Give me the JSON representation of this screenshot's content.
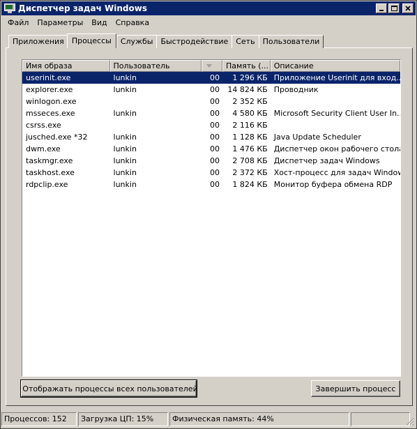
{
  "window": {
    "title": "Диспетчер задач Windows"
  },
  "menu": [
    "Файл",
    "Параметры",
    "Вид",
    "Справка"
  ],
  "tabs": [
    "Приложения",
    "Процессы",
    "Службы",
    "Быстродействие",
    "Сеть",
    "Пользователи"
  ],
  "active_tab": "Процессы",
  "table": {
    "columns": [
      "Имя образа",
      "Пользователь",
      "",
      "Память (...",
      "Описание"
    ],
    "rows": [
      [
        "userinit.exe",
        "lunkin",
        "00",
        "1 296 КБ",
        "Приложение Userinit для вход..."
      ],
      [
        "explorer.exe",
        "lunkin",
        "00",
        "14 824 КБ",
        "Проводник"
      ],
      [
        "winlogon.exe",
        "",
        "00",
        "2 352 КБ",
        ""
      ],
      [
        "msseces.exe",
        "lunkin",
        "00",
        "4 580 КБ",
        "Microsoft Security Client User In..."
      ],
      [
        "csrss.exe",
        "",
        "00",
        "2 116 КБ",
        ""
      ],
      [
        "jusched.exe *32",
        "lunkin",
        "00",
        "1 128 КБ",
        "Java Update Scheduler"
      ],
      [
        "dwm.exe",
        "lunkin",
        "00",
        "1 476 КБ",
        "Диспетчер окон рабочего стола"
      ],
      [
        "taskmgr.exe",
        "lunkin",
        "00",
        "2 708 КБ",
        "Диспетчер задач Windows"
      ],
      [
        "taskhost.exe",
        "lunkin",
        "00",
        "2 372 КБ",
        "Хост-процесс для задач Windows"
      ],
      [
        "rdpclip.exe",
        "lunkin",
        "00",
        "1 824 КБ",
        "Монитор буфера обмена RDP"
      ]
    ],
    "selected_row": 0
  },
  "buttons": {
    "show_all": "Отображать процессы всех пользователей",
    "end_process": "Завершить процесс"
  },
  "status": {
    "processes": "Процессов: 152",
    "cpu": "Загрузка ЦП: 15%",
    "memory": "Физическая память: 44%"
  },
  "colors": {
    "title_bg": "#0a246a",
    "selection": "#0a246a",
    "face": "#d4d0c8"
  },
  "icons": {
    "app": "task-manager-icon",
    "shield": "uac-shield-icon"
  }
}
